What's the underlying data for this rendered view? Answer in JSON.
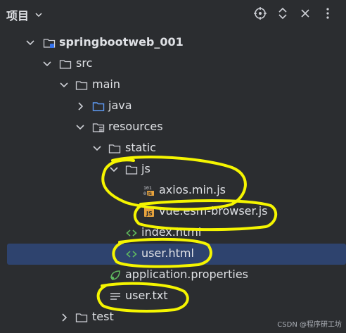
{
  "header": {
    "title": "项目",
    "title_icon": "chevron-down-icon",
    "icons": [
      "locate-icon",
      "expand-collapse-icon",
      "close-icon",
      "more-vertical-icon"
    ]
  },
  "tree": {
    "rows": [
      {
        "label": "springbootweb_001",
        "icon": "module-folder-icon",
        "expanded": true
      },
      {
        "label": "src",
        "icon": "folder-icon",
        "expanded": true
      },
      {
        "label": "main",
        "icon": "folder-icon",
        "expanded": true
      },
      {
        "label": "java",
        "icon": "source-folder-icon",
        "expanded": false
      },
      {
        "label": "resources",
        "icon": "resources-folder-icon",
        "expanded": true
      },
      {
        "label": "static",
        "icon": "folder-icon",
        "expanded": true
      },
      {
        "label": "js",
        "icon": "folder-icon",
        "expanded": true
      },
      {
        "label": "axios.min.js",
        "icon": "binary-js-icon"
      },
      {
        "label": "vue.esm-browser.js",
        "icon": "js-file-icon"
      },
      {
        "label": "index.html",
        "icon": "html-file-icon"
      },
      {
        "label": "user.html",
        "icon": "html-file-icon",
        "selected": true
      },
      {
        "label": "application.properties",
        "icon": "properties-file-icon"
      },
      {
        "label": "user.txt",
        "icon": "text-file-icon"
      },
      {
        "label": "test",
        "icon": "folder-icon",
        "expanded": false
      }
    ]
  },
  "watermark": "CSDN @程序研工坊",
  "colors": {
    "background": "#2b2d30",
    "selection": "#2e436e",
    "highlight": "#f5f500",
    "text": "#dfe1e5"
  }
}
